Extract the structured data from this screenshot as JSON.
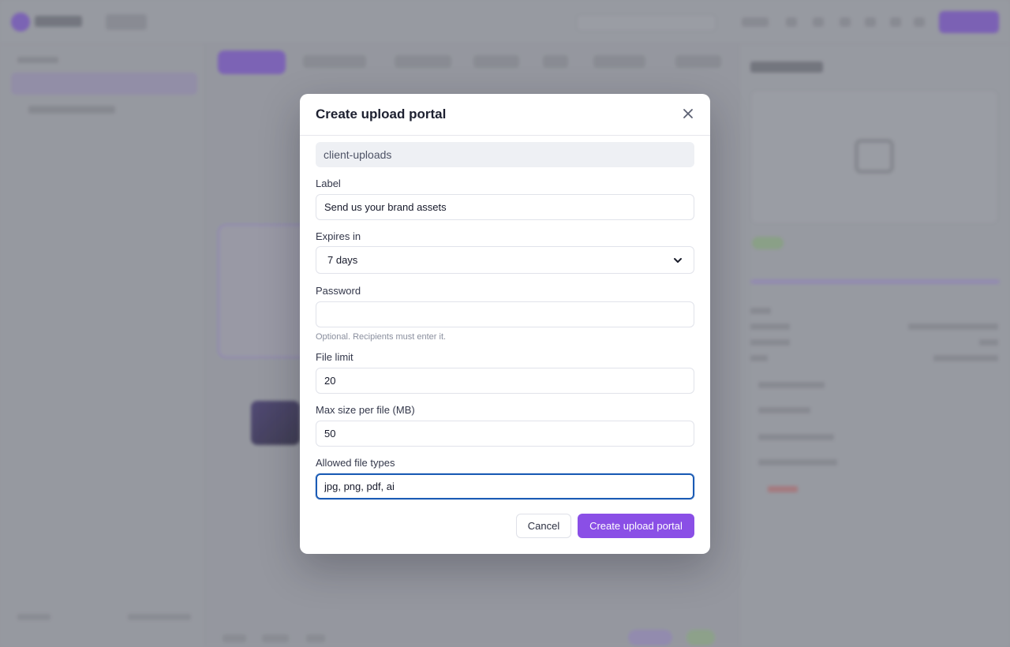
{
  "modal": {
    "title": "Create upload portal",
    "close_icon": "close-icon",
    "folder_value": "client-uploads",
    "label_field": {
      "label": "Label",
      "value": "Send us your brand assets"
    },
    "expires": {
      "label": "Expires in",
      "selected": "7 days",
      "icon": "chevron-down-icon"
    },
    "password": {
      "label": "Password",
      "value": "",
      "hint": "Optional. Recipients must enter it."
    },
    "file_limit": {
      "label": "File limit",
      "value": "20"
    },
    "max_size": {
      "label": "Max size per file (MB)",
      "value": "50"
    },
    "file_types": {
      "label": "Allowed file types",
      "value": "jpg, png, pdf, ai"
    },
    "cancel_label": "Cancel",
    "create_label": "Create upload portal"
  },
  "colors": {
    "accent": "#8a4fe6",
    "focus_ring": "#1b5bb5",
    "overlay": "#9ea0a7"
  }
}
